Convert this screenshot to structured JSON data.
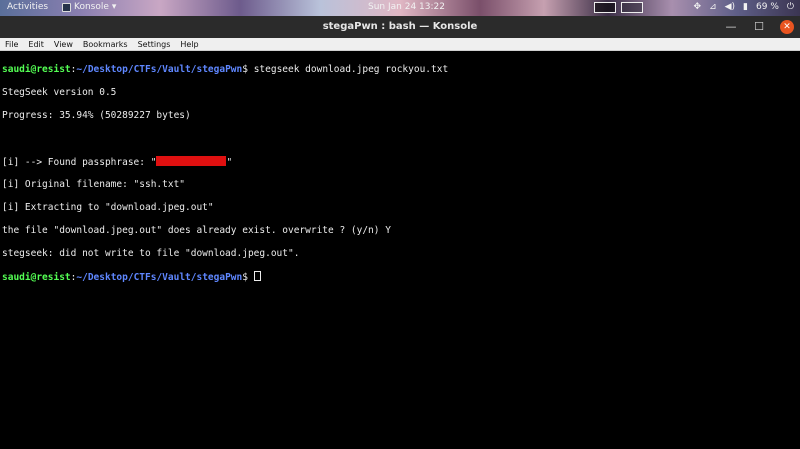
{
  "topbar": {
    "activities": "Activities",
    "app_name": "Konsole",
    "clock": "Sun Jan 24 13:22",
    "battery": "69 %"
  },
  "window": {
    "title": "stegaPwn : bash — Konsole"
  },
  "menu": [
    "File",
    "Edit",
    "View",
    "Bookmarks",
    "Settings",
    "Help"
  ],
  "terminal": {
    "user_host": "saudi@resist",
    "colon": ":",
    "path": "~/Desktop/CTFs/Vault/stegaPwn",
    "prompt_symbol": "$ ",
    "command1": "stegseek download.jpeg rockyou.txt",
    "out_version": "StegSeek version 0.5",
    "out_progress": "Progress: 35.94% (50289227 bytes)",
    "out_found_prefix": "[i] --> Found passphrase: \"",
    "out_found_suffix": "\"",
    "out_filename": "[i] Original filename: \"ssh.txt\"",
    "out_extract": "[i] Extracting to \"download.jpeg.out\"",
    "out_overwrite": "the file \"download.jpeg.out\" does already exist. overwrite ? (y/n) Y",
    "out_notwrite": "stegseek: did not write to file \"download.jpeg.out\"."
  },
  "colors": {
    "prompt_user": "#54ff54",
    "prompt_path": "#5f87ff",
    "redaction": "#e01010",
    "close_button": "#e95420"
  },
  "icons": [
    "app-icon",
    "dropdown-icon",
    "network-icon",
    "volume-icon",
    "power-icon",
    "battery-icon",
    "minimize-icon",
    "maximize-icon",
    "close-icon"
  ]
}
